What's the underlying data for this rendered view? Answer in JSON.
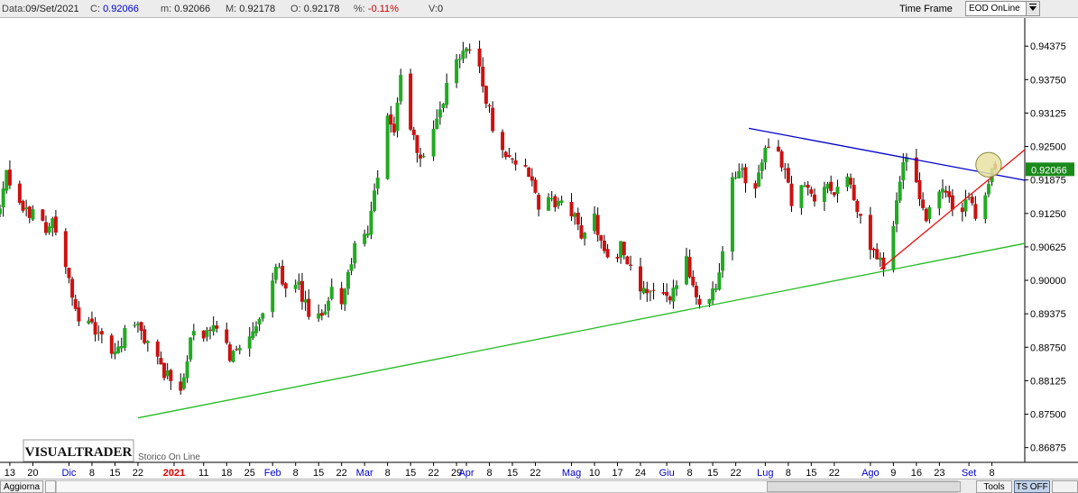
{
  "header": {
    "date_label": "Data:",
    "date_value": "09/Set/2021",
    "close_label": "C:",
    "close_value": "0.92066",
    "min_label": "m:",
    "min_value": "0.92066",
    "max_label": "M:",
    "max_value": "0.92178",
    "open_label": "O:",
    "open_value": "0.92178",
    "pct_label": "%:",
    "pct_value": "-0.11%",
    "volume_label": "V:",
    "volume_value": "0",
    "timeframe_label": "Time Frame",
    "timeframe_value": "EOD OnLine"
  },
  "footer": {
    "refresh_label": "Aggiorna",
    "tools_label": "Tools",
    "tsoff_label": "TS OFF"
  },
  "branding": {
    "logo_text": "VISUALTRADER",
    "storico_text": "Storico On Line"
  },
  "colors": {
    "bull": "#22aa22",
    "bear": "#cc1111",
    "wick": "#000000",
    "blue_line": "#0000cc",
    "red_line": "#ee1111",
    "green_line": "#22bb22",
    "price_box": "#1a8a1a",
    "ellipse_fill": "#e8e2a2",
    "month_label": "#0000cc",
    "year_label": "#dd0000"
  },
  "chart_data": {
    "type": "candlestick",
    "yaxis": {
      "ylim": [
        0.866,
        0.949
      ],
      "ticks": [
        "0.94375",
        "0.93750",
        "0.93125",
        "0.92500",
        "0.91875",
        "0.91250",
        "0.90625",
        "0.90000",
        "0.89375",
        "0.88750",
        "0.88125",
        "0.87500",
        "0.86875"
      ]
    },
    "last_price": "0.92066",
    "xaxis": {
      "start": "2020-11-10",
      "end": "2021-09-18",
      "ticks": [
        {
          "date": "2020-11-13",
          "label": "13",
          "kind": "day"
        },
        {
          "date": "2020-11-20",
          "label": "20",
          "kind": "day"
        },
        {
          "date": "2020-12-01",
          "label": "Dic",
          "kind": "month"
        },
        {
          "date": "2020-12-08",
          "label": "8",
          "kind": "day"
        },
        {
          "date": "2020-12-15",
          "label": "15",
          "kind": "day"
        },
        {
          "date": "2020-12-22",
          "label": "22",
          "kind": "day"
        },
        {
          "date": "2021-01-02",
          "label": "2021",
          "kind": "year"
        },
        {
          "date": "2021-01-11",
          "label": "11",
          "kind": "day"
        },
        {
          "date": "2021-01-18",
          "label": "18",
          "kind": "day"
        },
        {
          "date": "2021-01-25",
          "label": "25",
          "kind": "day"
        },
        {
          "date": "2021-02-01",
          "label": "Feb",
          "kind": "month"
        },
        {
          "date": "2021-02-08",
          "label": "8",
          "kind": "day"
        },
        {
          "date": "2021-02-15",
          "label": "15",
          "kind": "day"
        },
        {
          "date": "2021-02-22",
          "label": "22",
          "kind": "day"
        },
        {
          "date": "2021-03-01",
          "label": "Mar",
          "kind": "month"
        },
        {
          "date": "2021-03-08",
          "label": "8",
          "kind": "day"
        },
        {
          "date": "2021-03-15",
          "label": "15",
          "kind": "day"
        },
        {
          "date": "2021-03-22",
          "label": "22",
          "kind": "day"
        },
        {
          "date": "2021-03-29",
          "label": "29",
          "kind": "day"
        },
        {
          "date": "2021-04-01",
          "label": "Apr",
          "kind": "month"
        },
        {
          "date": "2021-04-08",
          "label": "8",
          "kind": "day"
        },
        {
          "date": "2021-04-15",
          "label": "15",
          "kind": "day"
        },
        {
          "date": "2021-04-22",
          "label": "22",
          "kind": "day"
        },
        {
          "date": "2021-05-03",
          "label": "Mag",
          "kind": "month"
        },
        {
          "date": "2021-05-10",
          "label": "10",
          "kind": "day"
        },
        {
          "date": "2021-05-17",
          "label": "17",
          "kind": "day"
        },
        {
          "date": "2021-05-24",
          "label": "24",
          "kind": "day"
        },
        {
          "date": "2021-06-01",
          "label": "Giu",
          "kind": "month"
        },
        {
          "date": "2021-06-08",
          "label": "8",
          "kind": "day"
        },
        {
          "date": "2021-06-15",
          "label": "15",
          "kind": "day"
        },
        {
          "date": "2021-06-22",
          "label": "22",
          "kind": "day"
        },
        {
          "date": "2021-07-01",
          "label": "Lug",
          "kind": "month"
        },
        {
          "date": "2021-07-08",
          "label": "8",
          "kind": "day"
        },
        {
          "date": "2021-07-15",
          "label": "15",
          "kind": "day"
        },
        {
          "date": "2021-07-22",
          "label": "22",
          "kind": "day"
        },
        {
          "date": "2021-08-02",
          "label": "Ago",
          "kind": "month"
        },
        {
          "date": "2021-08-09",
          "label": "9",
          "kind": "day"
        },
        {
          "date": "2021-08-16",
          "label": "16",
          "kind": "day"
        },
        {
          "date": "2021-08-23",
          "label": "23",
          "kind": "day"
        },
        {
          "date": "2021-09-01",
          "label": "Set",
          "kind": "month"
        },
        {
          "date": "2021-09-08",
          "label": "8",
          "kind": "day"
        }
      ]
    },
    "trendlines": [
      {
        "name": "blue-resistance",
        "color": "#0000cc",
        "from": [
          "2021-06-26",
          0.9284
        ],
        "to": [
          "2021-09-18",
          0.9187
        ]
      },
      {
        "name": "red-support",
        "color": "#ee1111",
        "from": [
          "2021-08-05",
          0.9021
        ],
        "to": [
          "2021-09-18",
          0.9244
        ]
      },
      {
        "name": "green-support",
        "color": "#22bb22",
        "from": [
          "2020-12-22",
          0.8743
        ],
        "to": [
          "2021-09-18",
          0.9069
        ]
      }
    ],
    "highlight_ellipse": {
      "date": "2021-09-07",
      "value": 0.9216,
      "rx_days": 3.0,
      "ry_value": 0.0023
    },
    "anchors": [
      [
        "2020-11-10",
        0.913
      ],
      [
        "2020-11-12",
        0.9195
      ],
      [
        "2020-11-16",
        0.9135
      ],
      [
        "2020-11-20",
        0.9125
      ],
      [
        "2020-11-24",
        0.91
      ],
      [
        "2020-11-26",
        0.911
      ],
      [
        "2020-11-30",
        0.903
      ],
      [
        "2020-12-02",
        0.896
      ],
      [
        "2020-12-04",
        0.8935
      ],
      [
        "2020-12-09",
        0.8905
      ],
      [
        "2020-12-15",
        0.886
      ],
      [
        "2020-12-18",
        0.89
      ],
      [
        "2020-12-22",
        0.8915
      ],
      [
        "2020-12-26",
        0.887
      ],
      [
        "2020-12-31",
        0.882
      ],
      [
        "2021-01-04",
        0.879
      ],
      [
        "2021-01-06",
        0.886
      ],
      [
        "2021-01-08",
        0.8905
      ],
      [
        "2021-01-12",
        0.8895
      ],
      [
        "2021-01-15",
        0.8915
      ],
      [
        "2021-01-19",
        0.886
      ],
      [
        "2021-01-21",
        0.888
      ],
      [
        "2021-01-25",
        0.8885
      ],
      [
        "2021-01-29",
        0.8935
      ],
      [
        "2021-02-01",
        0.8995
      ],
      [
        "2021-02-03",
        0.9035
      ],
      [
        "2021-02-05",
        0.8975
      ],
      [
        "2021-02-09",
        0.8985
      ],
      [
        "2021-02-12",
        0.8935
      ],
      [
        "2021-02-16",
        0.8925
      ],
      [
        "2021-02-19",
        0.899
      ],
      [
        "2021-02-22",
        0.8965
      ],
      [
        "2021-02-25",
        0.903
      ],
      [
        "2021-02-26",
        0.9065
      ],
      [
        "2021-03-01",
        0.9075
      ],
      [
        "2021-03-03",
        0.9125
      ],
      [
        "2021-03-05",
        0.919
      ],
      [
        "2021-03-08",
        0.9295
      ],
      [
        "2021-03-10",
        0.9285
      ],
      [
        "2021-03-12",
        0.938
      ],
      [
        "2021-03-15",
        0.9285
      ],
      [
        "2021-03-18",
        0.9225
      ],
      [
        "2021-03-22",
        0.927
      ],
      [
        "2021-03-25",
        0.933
      ],
      [
        "2021-03-27",
        0.9395
      ],
      [
        "2021-03-31",
        0.943
      ],
      [
        "2021-04-02",
        0.944
      ],
      [
        "2021-04-05",
        0.94
      ],
      [
        "2021-04-07",
        0.9335
      ],
      [
        "2021-04-09",
        0.929
      ],
      [
        "2021-04-13",
        0.924
      ],
      [
        "2021-04-16",
        0.922
      ],
      [
        "2021-04-20",
        0.92
      ],
      [
        "2021-04-23",
        0.9135
      ],
      [
        "2021-04-27",
        0.915
      ],
      [
        "2021-04-30",
        0.914
      ],
      [
        "2021-05-04",
        0.9115
      ],
      [
        "2021-05-06",
        0.909
      ],
      [
        "2021-05-10",
        0.9115
      ],
      [
        "2021-05-13",
        0.906
      ],
      [
        "2021-05-16",
        0.9
      ],
      [
        "2021-05-18",
        0.908
      ],
      [
        "2021-05-20",
        0.903
      ],
      [
        "2021-05-24",
        0.8975
      ],
      [
        "2021-05-28",
        0.898
      ],
      [
        "2021-06-01",
        0.896
      ],
      [
        "2021-06-04",
        0.8995
      ],
      [
        "2021-06-07",
        0.904
      ],
      [
        "2021-06-10",
        0.8965
      ],
      [
        "2021-06-14",
        0.8975
      ],
      [
        "2021-06-16",
        0.899
      ],
      [
        "2021-06-18",
        0.906
      ],
      [
        "2021-06-21",
        0.918
      ],
      [
        "2021-06-23",
        0.9215
      ],
      [
        "2021-06-25",
        0.918
      ],
      [
        "2021-06-28",
        0.9175
      ],
      [
        "2021-07-01",
        0.924
      ],
      [
        "2021-07-05",
        0.923
      ],
      [
        "2021-07-07",
        0.921
      ],
      [
        "2021-07-09",
        0.915
      ],
      [
        "2021-07-13",
        0.9175
      ],
      [
        "2021-07-16",
        0.915
      ],
      [
        "2021-07-19",
        0.918
      ],
      [
        "2021-07-22",
        0.917
      ],
      [
        "2021-07-26",
        0.9195
      ],
      [
        "2021-07-28",
        0.9145
      ],
      [
        "2021-08-02",
        0.9065
      ],
      [
        "2021-08-04",
        0.904
      ],
      [
        "2021-08-06",
        0.903
      ],
      [
        "2021-08-08",
        0.906
      ],
      [
        "2021-08-10",
        0.915
      ],
      [
        "2021-08-12",
        0.9215
      ],
      [
        "2021-08-14",
        0.9235
      ],
      [
        "2021-08-17",
        0.914
      ],
      [
        "2021-08-19",
        0.912
      ],
      [
        "2021-08-22",
        0.915
      ],
      [
        "2021-08-25",
        0.917
      ],
      [
        "2021-08-28",
        0.911
      ],
      [
        "2021-09-01",
        0.916
      ],
      [
        "2021-09-03",
        0.9125
      ],
      [
        "2021-09-06",
        0.915
      ],
      [
        "2021-09-08",
        0.9218
      ],
      [
        "2021-09-09",
        0.9207
      ]
    ]
  }
}
